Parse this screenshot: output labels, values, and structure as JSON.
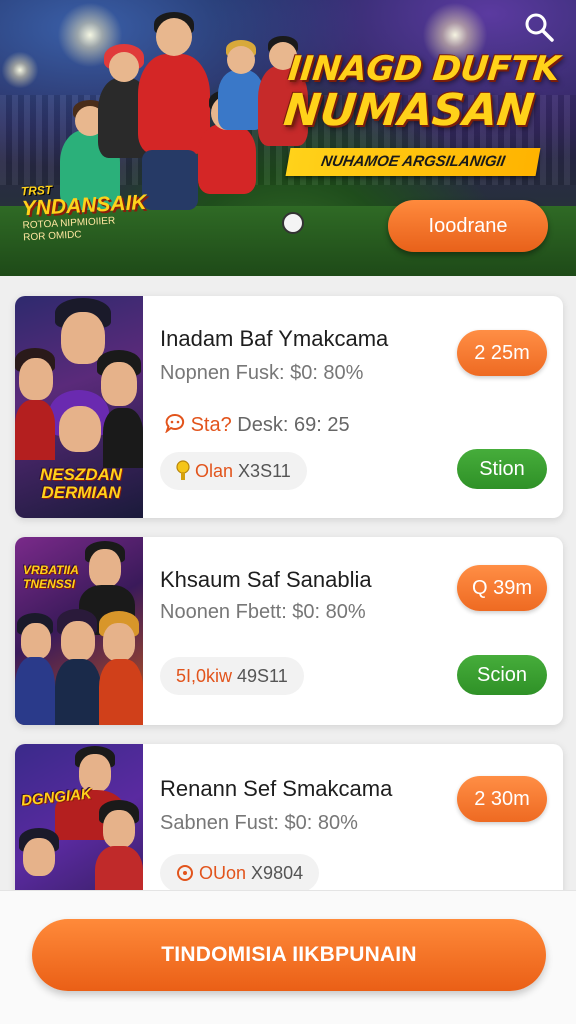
{
  "hero": {
    "title_line1": "IINAGD DUFTK",
    "title_line2": "NUMASAN",
    "subtitle": "NUHAMOE ARGSILANIGII",
    "cta_label": "Ioodrane",
    "logo_line1": "TRST",
    "logo_line2": "YNDANSAIK",
    "logo_line3": "ROTOA NIPMIOIIER",
    "logo_line4": "ROR OMIDC",
    "search_icon": "search-icon"
  },
  "cards": [
    {
      "title": "Inadam Baf Ymakcama",
      "meta": "Nopnen  Fusk: $0: 80%",
      "sub_accent": "Sta?",
      "sub_text": " Desk: 69: 25",
      "sub_icon": "chat-bubble-icon",
      "pill_accent": "Olan",
      "pill_text": " X3S11",
      "pill_icon": "medal-icon",
      "time": "2 25m",
      "action": "Stion",
      "thumb_logo": "NESZDAN DERMIAN"
    },
    {
      "title": "Khsaum Saf Sanablia",
      "meta": "Noonen  Fbett: $0: 80%",
      "pill_accent": "5I,0kiw",
      "pill_text": " 49S11",
      "time": "Q 39m",
      "action": "Scion",
      "thumb_logo": "VRBATIIA TNENSSI"
    },
    {
      "title": "Renann Sef Smakcama",
      "meta": "Sabnen  Fust: $0: 80%",
      "pill_accent": "OUon",
      "pill_text": " X9804",
      "pill_icon": "ring-icon",
      "time": "2 30m",
      "thumb_logo": "DGNGIAK"
    }
  ],
  "bottom": {
    "cta_label": "TINDOMISIA IIKBPUNAIN"
  },
  "colors": {
    "accent_orange": "#ee6a22",
    "action_green": "#2f9127",
    "title_yellow": "#ffd21a"
  }
}
